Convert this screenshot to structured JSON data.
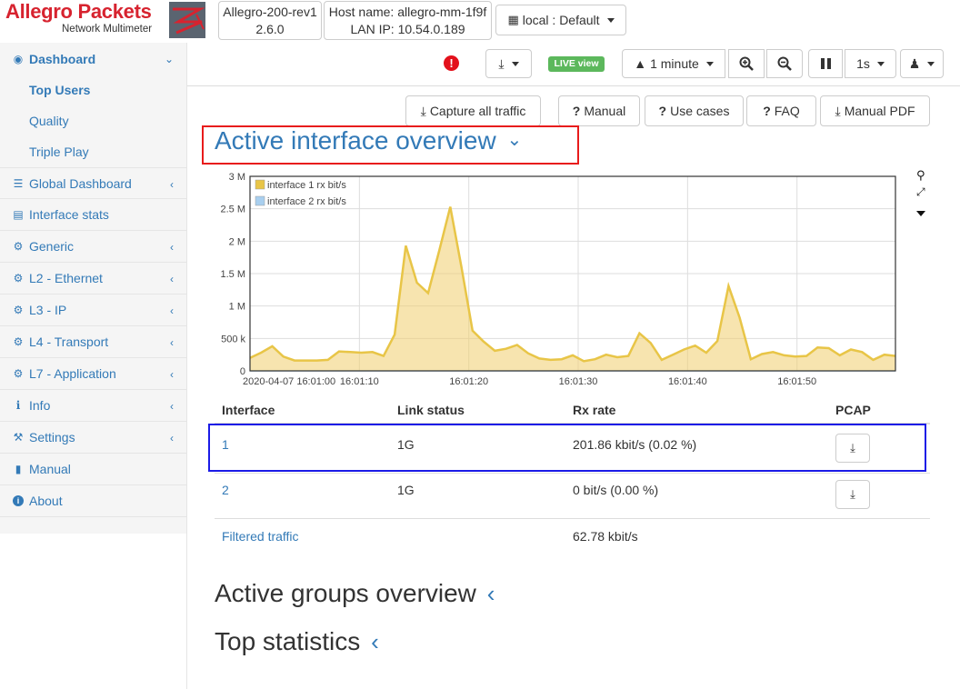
{
  "header": {
    "logo_title": "Allegro Packets",
    "logo_subtitle": "Network Multimeter",
    "device_name": "Allegro-200-rev1",
    "device_version": "2.6.0",
    "host_name": "Host name: allegro-mm-1f9f",
    "lan_ip": "LAN IP: 10.54.0.189",
    "layout_selector": "local : Default"
  },
  "toolbar": {
    "live_badge": "LIVE view",
    "time_range": "1 minute",
    "interval": "1s"
  },
  "sidebar": {
    "items": [
      {
        "label": "Dashboard",
        "icon": "dashboard-icon"
      },
      {
        "label": "Top Users"
      },
      {
        "label": "Quality"
      },
      {
        "label": "Triple Play"
      },
      {
        "label": "Global Dashboard",
        "icon": "server-icon"
      },
      {
        "label": "Interface stats",
        "icon": "bar-chart-icon"
      },
      {
        "label": "Generic",
        "icon": "gear-icon"
      },
      {
        "label": "L2 - Ethernet",
        "icon": "gear-icon"
      },
      {
        "label": "L3 - IP",
        "icon": "gear-icon"
      },
      {
        "label": "L4 - Transport",
        "icon": "gear-icon"
      },
      {
        "label": "L7 - Application",
        "icon": "gear-icon"
      },
      {
        "label": "Info",
        "icon": "info-icon"
      },
      {
        "label": "Settings",
        "icon": "wrench-icon"
      },
      {
        "label": "Manual",
        "icon": "book-icon"
      },
      {
        "label": "About",
        "icon": "info-circle-icon"
      }
    ]
  },
  "actions": {
    "capture": "Capture all traffic",
    "manual": "Manual",
    "use_cases": "Use cases",
    "faq": "FAQ",
    "manual_pdf": "Manual PDF"
  },
  "sections": {
    "interface_overview": "Active interface overview",
    "groups_overview": "Active groups overview",
    "top_statistics": "Top statistics"
  },
  "table": {
    "headers": [
      "Interface",
      "Link status",
      "Rx rate",
      "PCAP"
    ],
    "rows": [
      {
        "interface": "1",
        "link": "1G",
        "rx": "201.86 kbit/s (0.02 %)"
      },
      {
        "interface": "2",
        "link": "1G",
        "rx": "0 bit/s (0.00 %)"
      }
    ],
    "filtered_label": "Filtered traffic",
    "filtered_rx": "62.78 kbit/s"
  },
  "chart_data": {
    "type": "area",
    "title": "",
    "xlabel": "",
    "ylabel": "",
    "ylim": [
      0,
      3000000
    ],
    "yticks": [
      "0",
      "500 k",
      "1 M",
      "1.5 M",
      "2 M",
      "2.5 M",
      "3 M"
    ],
    "xticks": [
      "2020-04-07 16:01:00",
      "16:01:10",
      "16:01:20",
      "16:01:30",
      "16:01:40",
      "16:01:50"
    ],
    "legend_position": "top-left",
    "grid": true,
    "series": [
      {
        "name": "interface 1 rx bit/s",
        "color": "#e8c547",
        "values": [
          200000,
          280000,
          380000,
          220000,
          160000,
          160000,
          160000,
          170000,
          300000,
          290000,
          280000,
          290000,
          230000,
          560000,
          1930000,
          1360000,
          1200000,
          1850000,
          2530000,
          1600000,
          620000,
          450000,
          310000,
          340000,
          400000,
          270000,
          190000,
          170000,
          180000,
          240000,
          150000,
          180000,
          250000,
          210000,
          230000,
          580000,
          430000,
          170000,
          250000,
          330000,
          390000,
          280000,
          460000,
          1310000,
          820000,
          180000,
          260000,
          290000,
          240000,
          220000,
          230000,
          360000,
          350000,
          240000,
          330000,
          290000,
          170000,
          250000,
          230000
        ]
      },
      {
        "name": "interface 2 rx bit/s",
        "color": "#a9cfef",
        "values": [
          0,
          0,
          0,
          0,
          0,
          0,
          0,
          0,
          0,
          0,
          0,
          0,
          0,
          0,
          0,
          0,
          0,
          0,
          0,
          0,
          0,
          0,
          0,
          0,
          0,
          0,
          0,
          0,
          0,
          0,
          0,
          0,
          0,
          0,
          0,
          0,
          0,
          0,
          0,
          0,
          0,
          0,
          0,
          0,
          0,
          0,
          0,
          0,
          0,
          0,
          0,
          0,
          0,
          0,
          0,
          0,
          0,
          0,
          0
        ]
      }
    ]
  }
}
